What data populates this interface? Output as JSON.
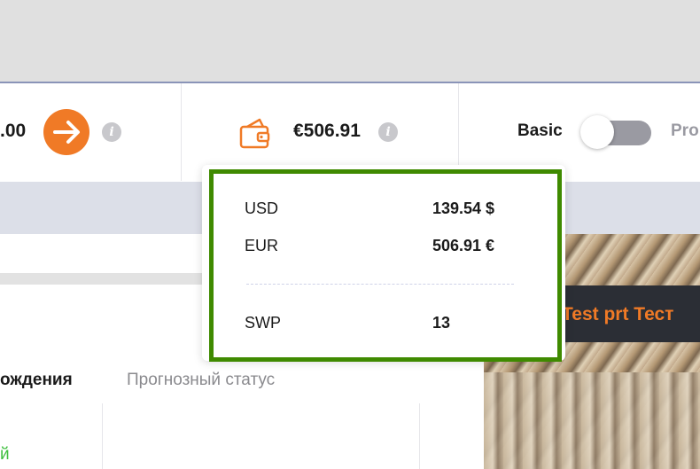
{
  "header": {
    "balance_amount": ".00",
    "wallet_amount": "€506.91",
    "info_glyph": "i",
    "toggle": {
      "left_label": "Basic",
      "right_label": "Pro",
      "state": "off"
    }
  },
  "tooltip": {
    "rows": [
      {
        "currency": "USD",
        "value": "139.54 $"
      },
      {
        "currency": "EUR",
        "value": "506.91 €"
      },
      {
        "currency": "SWP",
        "value": "13"
      }
    ]
  },
  "table": {
    "col1_header": "ождения",
    "col2_header": "Прогнозный статус",
    "row1_partial": "й"
  },
  "promo": {
    "text": "Test prt Тест"
  },
  "colors": {
    "accent_orange": "#f07a26",
    "highlight_green": "#3f8a00",
    "status_green": "#3fbf3f",
    "info_gray": "#c8c8cc"
  },
  "icons": {
    "arrow": "arrow-right-icon",
    "wallet": "wallet-icon",
    "info": "info-icon"
  }
}
